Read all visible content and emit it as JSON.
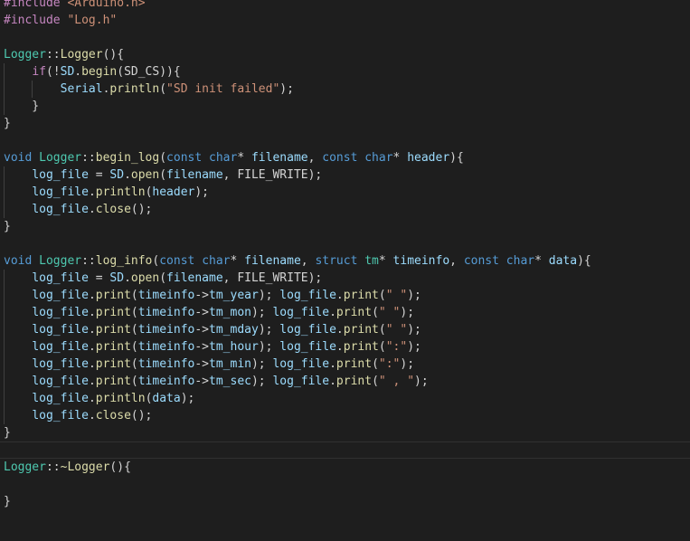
{
  "editor": {
    "current_line": 27,
    "lines": [
      {
        "indent": 0,
        "tokens": [
          [
            "#include ",
            "c"
          ],
          [
            "<Arduino.h>",
            "s"
          ]
        ]
      },
      {
        "indent": 0,
        "tokens": [
          [
            "#include ",
            "c"
          ],
          [
            "\"Log.h\"",
            "s"
          ]
        ]
      },
      {
        "indent": 0,
        "tokens": []
      },
      {
        "indent": 0,
        "tokens": [
          [
            "Logger",
            "t"
          ],
          [
            "::",
            "p"
          ],
          [
            "Logger",
            "f"
          ],
          [
            "(){",
            "p"
          ]
        ]
      },
      {
        "indent": 1,
        "tokens": [
          [
            "    ",
            "p"
          ],
          [
            "if",
            "c"
          ],
          [
            "(!",
            "p"
          ],
          [
            "SD",
            "v"
          ],
          [
            ".",
            "p"
          ],
          [
            "begin",
            "f"
          ],
          [
            "(SD_CS)){",
            "p"
          ]
        ]
      },
      {
        "indent": 2,
        "tokens": [
          [
            "        ",
            "p"
          ],
          [
            "Serial",
            "v"
          ],
          [
            ".",
            "p"
          ],
          [
            "println",
            "f"
          ],
          [
            "(",
            "p"
          ],
          [
            "\"SD init failed\"",
            "s"
          ],
          [
            ");",
            "p"
          ]
        ]
      },
      {
        "indent": 1,
        "tokens": [
          [
            "    }",
            "p"
          ]
        ]
      },
      {
        "indent": 0,
        "tokens": [
          [
            "}",
            "p"
          ]
        ]
      },
      {
        "indent": 0,
        "tokens": []
      },
      {
        "indent": 0,
        "tokens": [
          [
            "void ",
            "k"
          ],
          [
            "Logger",
            "t"
          ],
          [
            "::",
            "p"
          ],
          [
            "begin_log",
            "f"
          ],
          [
            "(",
            "p"
          ],
          [
            "const ",
            "k"
          ],
          [
            "char",
            "k"
          ],
          [
            "* ",
            "p"
          ],
          [
            "filename",
            "v"
          ],
          [
            ", ",
            "p"
          ],
          [
            "const ",
            "k"
          ],
          [
            "char",
            "k"
          ],
          [
            "* ",
            "p"
          ],
          [
            "header",
            "v"
          ],
          [
            "){",
            "p"
          ]
        ]
      },
      {
        "indent": 1,
        "tokens": [
          [
            "    ",
            "p"
          ],
          [
            "log_file",
            "v"
          ],
          [
            " = ",
            "p"
          ],
          [
            "SD",
            "v"
          ],
          [
            ".",
            "p"
          ],
          [
            "open",
            "f"
          ],
          [
            "(",
            "p"
          ],
          [
            "filename",
            "v"
          ],
          [
            ", FILE_WRITE);",
            "p"
          ]
        ]
      },
      {
        "indent": 1,
        "tokens": [
          [
            "    ",
            "p"
          ],
          [
            "log_file",
            "v"
          ],
          [
            ".",
            "p"
          ],
          [
            "println",
            "f"
          ],
          [
            "(",
            "p"
          ],
          [
            "header",
            "v"
          ],
          [
            ");",
            "p"
          ]
        ]
      },
      {
        "indent": 1,
        "tokens": [
          [
            "    ",
            "p"
          ],
          [
            "log_file",
            "v"
          ],
          [
            ".",
            "p"
          ],
          [
            "close",
            "f"
          ],
          [
            "();",
            "p"
          ]
        ]
      },
      {
        "indent": 0,
        "tokens": [
          [
            "}",
            "p"
          ]
        ]
      },
      {
        "indent": 0,
        "tokens": []
      },
      {
        "indent": 0,
        "tokens": [
          [
            "void ",
            "k"
          ],
          [
            "Logger",
            "t"
          ],
          [
            "::",
            "p"
          ],
          [
            "log_info",
            "f"
          ],
          [
            "(",
            "p"
          ],
          [
            "const ",
            "k"
          ],
          [
            "char",
            "k"
          ],
          [
            "* ",
            "p"
          ],
          [
            "filename",
            "v"
          ],
          [
            ", ",
            "p"
          ],
          [
            "struct ",
            "k"
          ],
          [
            "tm",
            "t"
          ],
          [
            "* ",
            "p"
          ],
          [
            "timeinfo",
            "v"
          ],
          [
            ", ",
            "p"
          ],
          [
            "const ",
            "k"
          ],
          [
            "char",
            "k"
          ],
          [
            "* ",
            "p"
          ],
          [
            "data",
            "v"
          ],
          [
            "){",
            "p"
          ]
        ]
      },
      {
        "indent": 1,
        "tokens": [
          [
            "    ",
            "p"
          ],
          [
            "log_file",
            "v"
          ],
          [
            " = ",
            "p"
          ],
          [
            "SD",
            "v"
          ],
          [
            ".",
            "p"
          ],
          [
            "open",
            "f"
          ],
          [
            "(",
            "p"
          ],
          [
            "filename",
            "v"
          ],
          [
            ", FILE_WRITE);",
            "p"
          ]
        ]
      },
      {
        "indent": 1,
        "tokens": [
          [
            "    ",
            "p"
          ],
          [
            "log_file",
            "v"
          ],
          [
            ".",
            "p"
          ],
          [
            "print",
            "f"
          ],
          [
            "(",
            "p"
          ],
          [
            "timeinfo",
            "v"
          ],
          [
            "->",
            "p"
          ],
          [
            "tm_year",
            "v"
          ],
          [
            "); ",
            "p"
          ],
          [
            "log_file",
            "v"
          ],
          [
            ".",
            "p"
          ],
          [
            "print",
            "f"
          ],
          [
            "(",
            "p"
          ],
          [
            "\" \"",
            "s"
          ],
          [
            ");",
            "p"
          ]
        ]
      },
      {
        "indent": 1,
        "tokens": [
          [
            "    ",
            "p"
          ],
          [
            "log_file",
            "v"
          ],
          [
            ".",
            "p"
          ],
          [
            "print",
            "f"
          ],
          [
            "(",
            "p"
          ],
          [
            "timeinfo",
            "v"
          ],
          [
            "->",
            "p"
          ],
          [
            "tm_mon",
            "v"
          ],
          [
            "); ",
            "p"
          ],
          [
            "log_file",
            "v"
          ],
          [
            ".",
            "p"
          ],
          [
            "print",
            "f"
          ],
          [
            "(",
            "p"
          ],
          [
            "\" \"",
            "s"
          ],
          [
            ");",
            "p"
          ]
        ]
      },
      {
        "indent": 1,
        "tokens": [
          [
            "    ",
            "p"
          ],
          [
            "log_file",
            "v"
          ],
          [
            ".",
            "p"
          ],
          [
            "print",
            "f"
          ],
          [
            "(",
            "p"
          ],
          [
            "timeinfo",
            "v"
          ],
          [
            "->",
            "p"
          ],
          [
            "tm_mday",
            "v"
          ],
          [
            "); ",
            "p"
          ],
          [
            "log_file",
            "v"
          ],
          [
            ".",
            "p"
          ],
          [
            "print",
            "f"
          ],
          [
            "(",
            "p"
          ],
          [
            "\" \"",
            "s"
          ],
          [
            ");",
            "p"
          ]
        ]
      },
      {
        "indent": 1,
        "tokens": [
          [
            "    ",
            "p"
          ],
          [
            "log_file",
            "v"
          ],
          [
            ".",
            "p"
          ],
          [
            "print",
            "f"
          ],
          [
            "(",
            "p"
          ],
          [
            "timeinfo",
            "v"
          ],
          [
            "->",
            "p"
          ],
          [
            "tm_hour",
            "v"
          ],
          [
            "); ",
            "p"
          ],
          [
            "log_file",
            "v"
          ],
          [
            ".",
            "p"
          ],
          [
            "print",
            "f"
          ],
          [
            "(",
            "p"
          ],
          [
            "\":\"",
            "s"
          ],
          [
            ");",
            "p"
          ]
        ]
      },
      {
        "indent": 1,
        "tokens": [
          [
            "    ",
            "p"
          ],
          [
            "log_file",
            "v"
          ],
          [
            ".",
            "p"
          ],
          [
            "print",
            "f"
          ],
          [
            "(",
            "p"
          ],
          [
            "timeinfo",
            "v"
          ],
          [
            "->",
            "p"
          ],
          [
            "tm_min",
            "v"
          ],
          [
            "); ",
            "p"
          ],
          [
            "log_file",
            "v"
          ],
          [
            ".",
            "p"
          ],
          [
            "print",
            "f"
          ],
          [
            "(",
            "p"
          ],
          [
            "\":\"",
            "s"
          ],
          [
            ");",
            "p"
          ]
        ]
      },
      {
        "indent": 1,
        "tokens": [
          [
            "    ",
            "p"
          ],
          [
            "log_file",
            "v"
          ],
          [
            ".",
            "p"
          ],
          [
            "print",
            "f"
          ],
          [
            "(",
            "p"
          ],
          [
            "timeinfo",
            "v"
          ],
          [
            "->",
            "p"
          ],
          [
            "tm_sec",
            "v"
          ],
          [
            "); ",
            "p"
          ],
          [
            "log_file",
            "v"
          ],
          [
            ".",
            "p"
          ],
          [
            "print",
            "f"
          ],
          [
            "(",
            "p"
          ],
          [
            "\" , \"",
            "s"
          ],
          [
            ");",
            "p"
          ]
        ]
      },
      {
        "indent": 1,
        "tokens": [
          [
            "    ",
            "p"
          ],
          [
            "log_file",
            "v"
          ],
          [
            ".",
            "p"
          ],
          [
            "println",
            "f"
          ],
          [
            "(",
            "p"
          ],
          [
            "data",
            "v"
          ],
          [
            ");",
            "p"
          ]
        ]
      },
      {
        "indent": 1,
        "tokens": [
          [
            "    ",
            "p"
          ],
          [
            "log_file",
            "v"
          ],
          [
            ".",
            "p"
          ],
          [
            "close",
            "f"
          ],
          [
            "();",
            "p"
          ]
        ]
      },
      {
        "indent": 0,
        "tokens": [
          [
            "}",
            "p"
          ]
        ]
      },
      {
        "indent": 0,
        "tokens": []
      },
      {
        "indent": 0,
        "tokens": [
          [
            "Logger",
            "t"
          ],
          [
            "::",
            "p"
          ],
          [
            "~Logger",
            "f"
          ],
          [
            "(){",
            "p"
          ]
        ]
      },
      {
        "indent": 0,
        "tokens": []
      },
      {
        "indent": 0,
        "tokens": [
          [
            "}",
            "p"
          ]
        ]
      }
    ]
  }
}
